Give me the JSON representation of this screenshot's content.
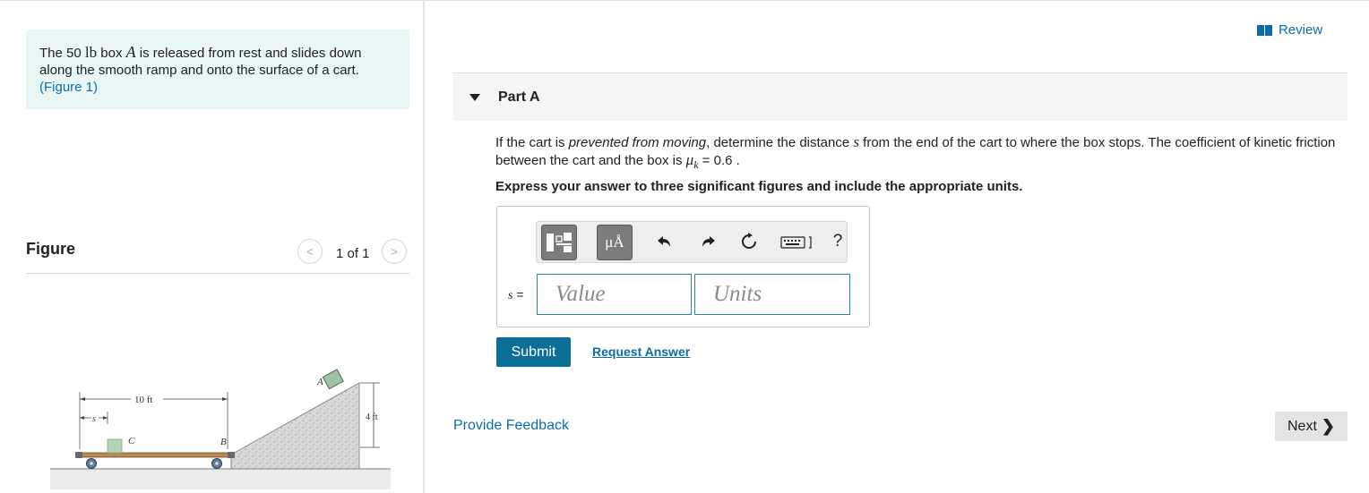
{
  "intro": {
    "text_1": "The 50 ",
    "unit_lb": "lb",
    "text_2": " box ",
    "var_A": "A",
    "text_3": " is released from rest and slides down along the smooth ramp and onto the surface of a cart.",
    "figure_link": "(Figure 1)"
  },
  "figure_panel": {
    "title": "Figure",
    "pager": "1 of 1",
    "labels": {
      "dist_10ft": "10 ft",
      "s": "s",
      "C": "C",
      "B": "B",
      "A": "A",
      "height_4ft": "4 ft"
    }
  },
  "review": {
    "label": "Review"
  },
  "part": {
    "title": "Part A"
  },
  "question": {
    "text_1": "If the cart is ",
    "emph": "prevented from moving",
    "text_2": ", determine the distance ",
    "var_s": "s",
    "text_3": " from the end of the cart to where the box stops. The coefficient of kinetic friction between the cart and the box is ",
    "mu": "μ",
    "mu_sub": "k",
    "text_4": " = 0.6 ."
  },
  "instruction": "Express your answer to three significant figures and include the appropriate units.",
  "answer": {
    "units_button": "μÅ",
    "help": "?",
    "label_var": "s",
    "label_eq": " =",
    "value_placeholder": "Value",
    "units_placeholder": "Units"
  },
  "buttons": {
    "submit": "Submit",
    "request_answer": "Request Answer",
    "provide_feedback": "Provide Feedback",
    "next": "Next"
  },
  "colors": {
    "link": "#0d6ca8",
    "submit_bg": "#0a6e96",
    "intro_bg": "#e9f6f6"
  }
}
